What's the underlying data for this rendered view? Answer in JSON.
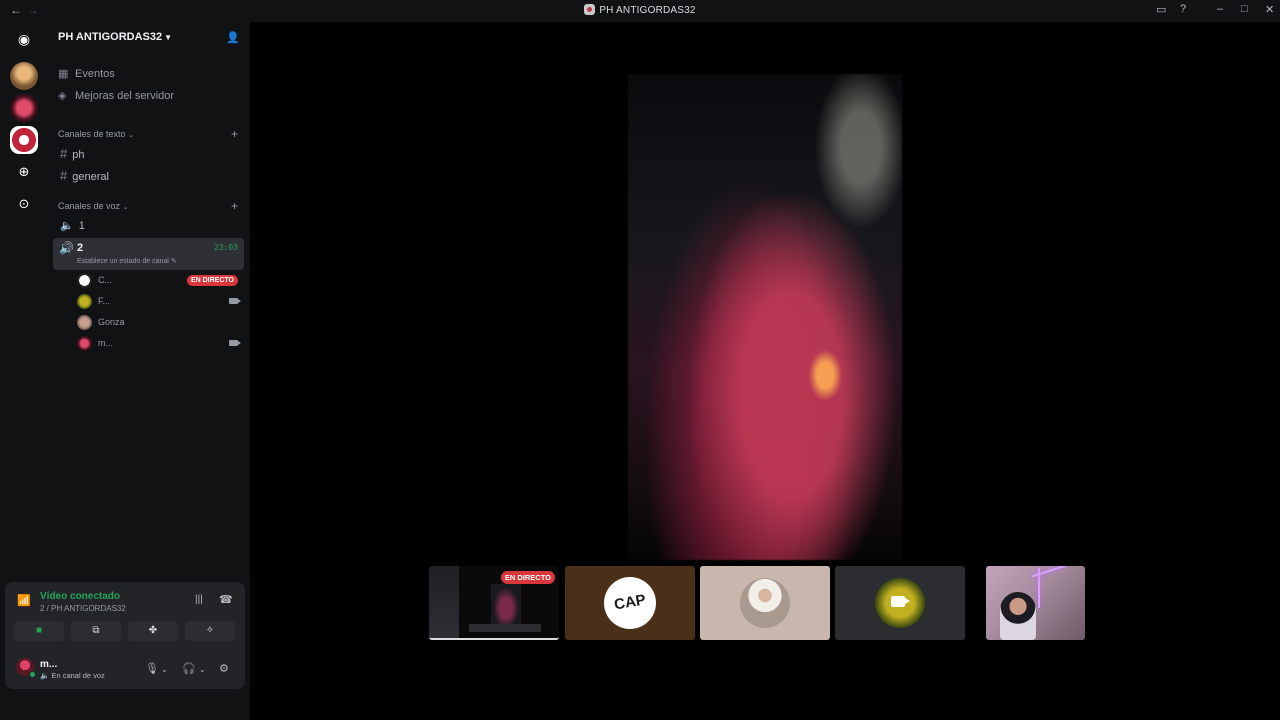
{
  "window": {
    "title": "PH ANTIGORDAS32"
  },
  "sidebar": {
    "server_name": "PH ANTIGORDAS32",
    "top_items": [
      {
        "label": "Eventos",
        "icon": "calendar-icon"
      },
      {
        "label": "Mejoras del servidor",
        "icon": "boost-icon"
      }
    ],
    "text_category": "Canales de texto",
    "text_channels": [
      "ph",
      "general"
    ],
    "voice_category": "Canales de voz",
    "voice_channels": [
      {
        "name": "1"
      },
      {
        "name": "2",
        "timer": "23:03",
        "status": "Establece un estado de canal"
      }
    ],
    "members": [
      {
        "name": "C...",
        "badge": "EN DIRECTO"
      },
      {
        "name": "F...",
        "camera": true
      },
      {
        "name": "Gonza"
      },
      {
        "name": "m...",
        "camera": true
      }
    ]
  },
  "user_panel": {
    "connection_title": "Vídeo conectado",
    "connection_sub": "2 / PH ANTIGORDAS32",
    "username": "m...",
    "user_status": "En canal de voz"
  },
  "stage": {
    "thumb_live_badge": "EN DIRECTO",
    "crest_text": "CAP"
  },
  "colors": {
    "green": "#23a55a",
    "red_badge": "#da373c",
    "bg": "#111214"
  }
}
